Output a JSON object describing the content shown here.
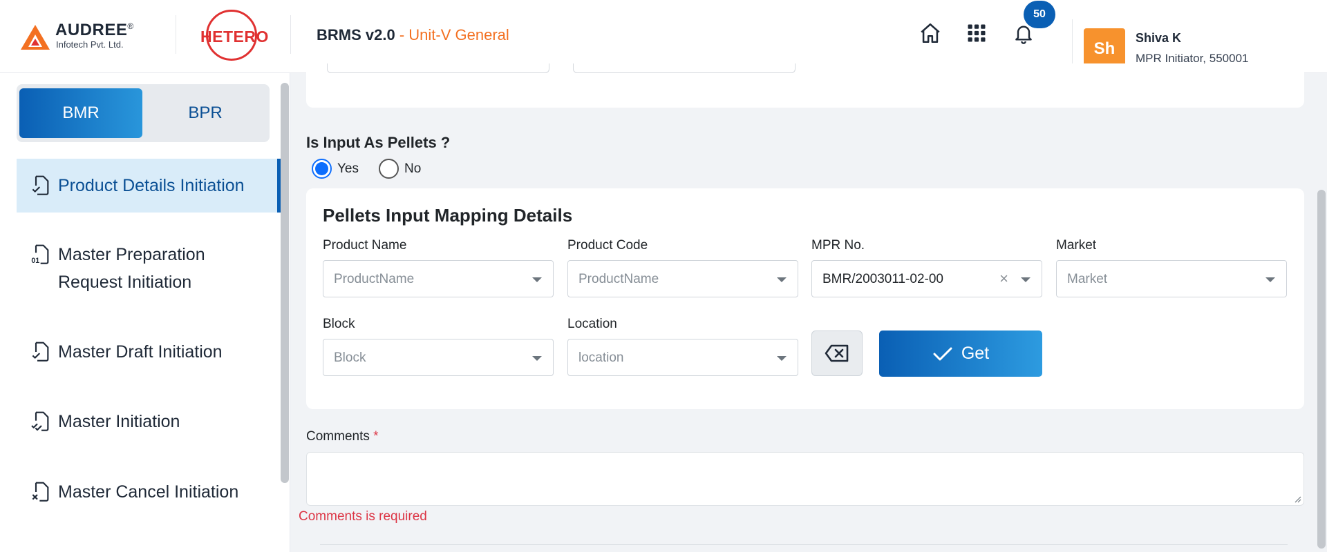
{
  "header": {
    "brand_name": "AUDREE",
    "brand_reg": "®",
    "brand_sub": "Infotech Pvt. Ltd.",
    "partner_logo": "HETERO",
    "app_name": "BRMS v2.0",
    "app_unit": " - Unit-V General",
    "icons": [
      "home-icon",
      "apps-grid-icon",
      "bell-icon"
    ],
    "notification_count": "50",
    "user_initials": "Sh",
    "user_name": "Shiva K",
    "user_role": "MPR Initiator, 550001"
  },
  "sidebar": {
    "tabs": [
      {
        "label": "BMR",
        "active": true
      },
      {
        "label": "BPR",
        "active": false
      }
    ],
    "items": [
      {
        "label": "Product Details Initiation",
        "icon": "document-check-icon",
        "active": true
      },
      {
        "label_line1": "Master Preparation",
        "label_line2": "Request Initiation",
        "icon": "document-binary-icon",
        "active": false
      },
      {
        "label": "Master Draft Initiation",
        "icon": "document-check-icon",
        "active": false
      },
      {
        "label": "Master Initiation",
        "icon": "document-double-check-icon",
        "active": false
      },
      {
        "label": "Master Cancel Initiation",
        "icon": "document-cancel-icon",
        "active": false
      }
    ]
  },
  "main": {
    "pellets_question": "Is Input As Pellets ?",
    "radio_options": [
      {
        "label": "Yes",
        "selected": true
      },
      {
        "label": "No",
        "selected": false
      }
    ],
    "mapping_card": {
      "title": "Pellets Input Mapping Details",
      "fields": {
        "product_name": {
          "label": "Product Name",
          "value": "ProductName"
        },
        "product_code": {
          "label": "Product Code",
          "value": "ProductName"
        },
        "mpr_no": {
          "label": "MPR No.",
          "value": "BMR/2003011-02-00"
        },
        "market": {
          "label": "Market",
          "value": "Market"
        },
        "block": {
          "label": "Block",
          "value": "Block"
        },
        "location": {
          "label": "Location",
          "value": "location"
        }
      },
      "get_button": "Get"
    },
    "comments_label": "Comments",
    "comments_required_mark": "*",
    "comments_value": "",
    "comments_error": "Comments is required"
  },
  "colors": {
    "primary": "#0a5fb4",
    "accent_orange": "#f37021",
    "error": "#dc3545",
    "brand_red": "#e03131"
  }
}
